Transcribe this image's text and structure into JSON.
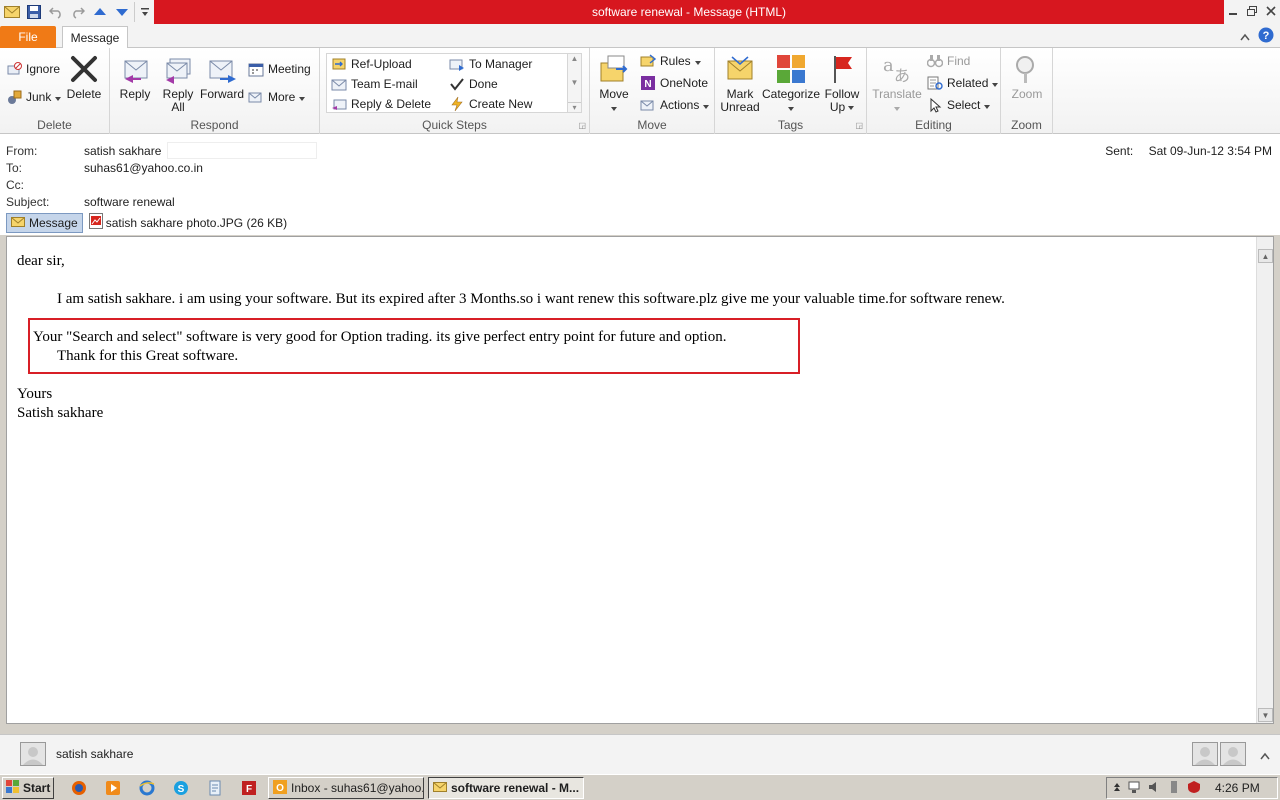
{
  "window": {
    "title": "software renewal  -  Message (HTML)"
  },
  "tabs": {
    "file": "File",
    "message": "Message"
  },
  "ribbon": {
    "delete_group": {
      "label": "Delete",
      "ignore": "Ignore",
      "junk": "Junk",
      "delete": "Delete"
    },
    "respond_group": {
      "label": "Respond",
      "reply": "Reply",
      "reply_all_1": "Reply",
      "reply_all_2": "All",
      "forward": "Forward",
      "meeting": "Meeting",
      "more": "More"
    },
    "quick_steps_group": {
      "label": "Quick Steps",
      "items": [
        "Ref-Upload",
        "To Manager",
        "Team E-mail",
        "Done",
        "Reply & Delete",
        "Create New"
      ]
    },
    "move_group": {
      "label": "Move",
      "move": "Move",
      "rules": "Rules",
      "onenote": "OneNote",
      "actions": "Actions"
    },
    "tags_group": {
      "label": "Tags",
      "mark_1": "Mark",
      "mark_2": "Unread",
      "categorize": "Categorize",
      "follow_1": "Follow",
      "follow_2": "Up"
    },
    "editing_group": {
      "label": "Editing",
      "translate": "Translate",
      "find": "Find",
      "related": "Related",
      "select": "Select"
    },
    "zoom_group": {
      "label": "Zoom",
      "zoom": "Zoom"
    }
  },
  "header": {
    "from_label": "From:",
    "from_value": "satish sakhare",
    "to_label": "To:",
    "to_value": "suhas61@yahoo.co.in",
    "cc_label": "Cc:",
    "cc_value": "",
    "subject_label": "Subject:",
    "subject_value": "software renewal",
    "sent_label": "Sent:",
    "sent_value": "Sat 09-Jun-12 3:54 PM",
    "message_tab": "Message",
    "attachment": "satish sakhare photo.JPG (26 KB)"
  },
  "body": {
    "greeting": "dear sir,",
    "para1": "I am satish sakhare. i am using your software. But its expired after 3 Months.so i want renew this software.plz give me your valuable time.for software renew.",
    "para2": "Your \"Search and select\" software is very good for Option trading. its give perfect entry point for future and option.",
    "para3": "Thank for this Great software.",
    "closing": "Yours",
    "signature": "Satish sakhare"
  },
  "people_pane": {
    "name": "satish sakhare"
  },
  "taskbar": {
    "start": "Start",
    "buttons": [
      "Inbox - suhas61@yahoo....",
      "software renewal - M..."
    ],
    "clock": "4:26 PM"
  },
  "colors": {
    "title_bar": "#d7171f",
    "file_tab": "#f07a16",
    "highlight_box": "#d81f26"
  }
}
